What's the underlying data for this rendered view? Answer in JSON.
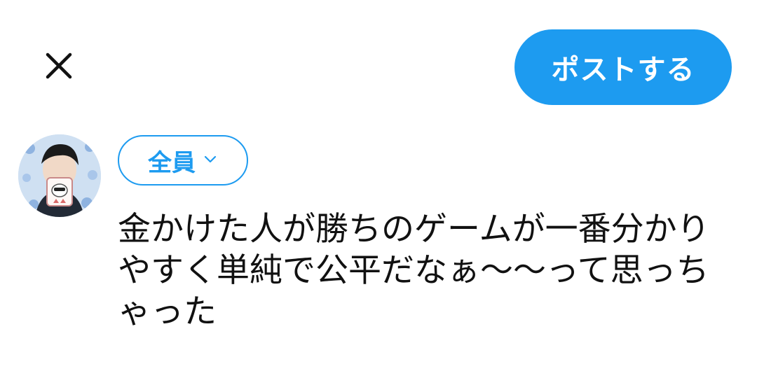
{
  "header": {
    "close_icon": "close-icon",
    "post_button_label": "ポストする",
    "accent_color": "#1d9bf0"
  },
  "composer": {
    "avatar_icon": "user-avatar",
    "audience_label": "全員",
    "audience_icon": "chevron-down-icon",
    "text": "金かけた人が勝ちのゲームが一番分かりやすく単純で公平だなぁ〜〜って思っちゃった"
  }
}
